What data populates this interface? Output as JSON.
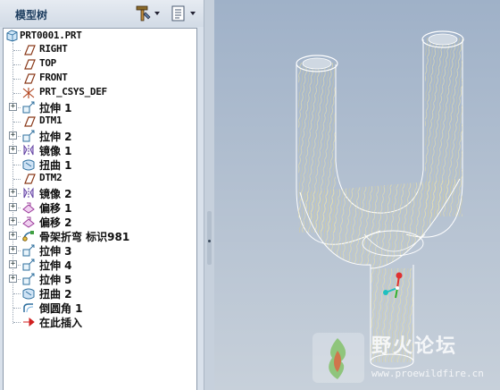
{
  "panel": {
    "title": "模型树",
    "tools": [
      {
        "icon": "model-tree-settings-icon"
      },
      {
        "icon": "show-menu-icon"
      }
    ]
  },
  "tree": {
    "root": {
      "label": "PRT0001.PRT",
      "icon": "part-icon"
    },
    "items": [
      {
        "label": "RIGHT",
        "icon": "datum-plane-icon",
        "expandable": false
      },
      {
        "label": "TOP",
        "icon": "datum-plane-icon",
        "expandable": false
      },
      {
        "label": "FRONT",
        "icon": "datum-plane-icon",
        "expandable": false
      },
      {
        "label": "PRT_CSYS_DEF",
        "icon": "coordinate-system-icon",
        "expandable": false
      },
      {
        "label": "拉伸 1",
        "icon": "extrude-icon",
        "expandable": true
      },
      {
        "label": "DTM1",
        "icon": "datum-plane-icon",
        "expandable": false
      },
      {
        "label": "拉伸 2",
        "icon": "extrude-icon",
        "expandable": true
      },
      {
        "label": "镜像 1",
        "icon": "mirror-icon",
        "expandable": true
      },
      {
        "label": "扭曲 1",
        "icon": "warp-icon",
        "expandable": false
      },
      {
        "label": "DTM2",
        "icon": "datum-plane-icon",
        "expandable": false
      },
      {
        "label": "镜像 2",
        "icon": "mirror-icon",
        "expandable": true
      },
      {
        "label": "偏移 1",
        "icon": "offset-icon",
        "expandable": true
      },
      {
        "label": "偏移 2",
        "icon": "offset-icon",
        "expandable": true
      },
      {
        "label": "骨架折弯 标识981",
        "icon": "spinal-bend-icon",
        "expandable": true
      },
      {
        "label": "拉伸 3",
        "icon": "extrude-icon",
        "expandable": true
      },
      {
        "label": "拉伸 4",
        "icon": "extrude-icon",
        "expandable": true
      },
      {
        "label": "拉伸 5",
        "icon": "extrude-icon",
        "expandable": true
      },
      {
        "label": "扭曲 2",
        "icon": "warp-icon",
        "expandable": false
      },
      {
        "label": "倒圆角 1",
        "icon": "round-icon",
        "expandable": false
      },
      {
        "label": "在此插入",
        "icon": "insert-here-arrow-icon",
        "expandable": false
      }
    ]
  },
  "watermark": {
    "title": "野火论坛",
    "url": "www.proewildfire.cn"
  },
  "colors": {
    "panel_bg": "#d9e1eb",
    "tree_bg": "#ffffff",
    "viewport_bg": "#b4c1d1",
    "wire": "#ffffff",
    "hatch": "#e8dfa8"
  }
}
